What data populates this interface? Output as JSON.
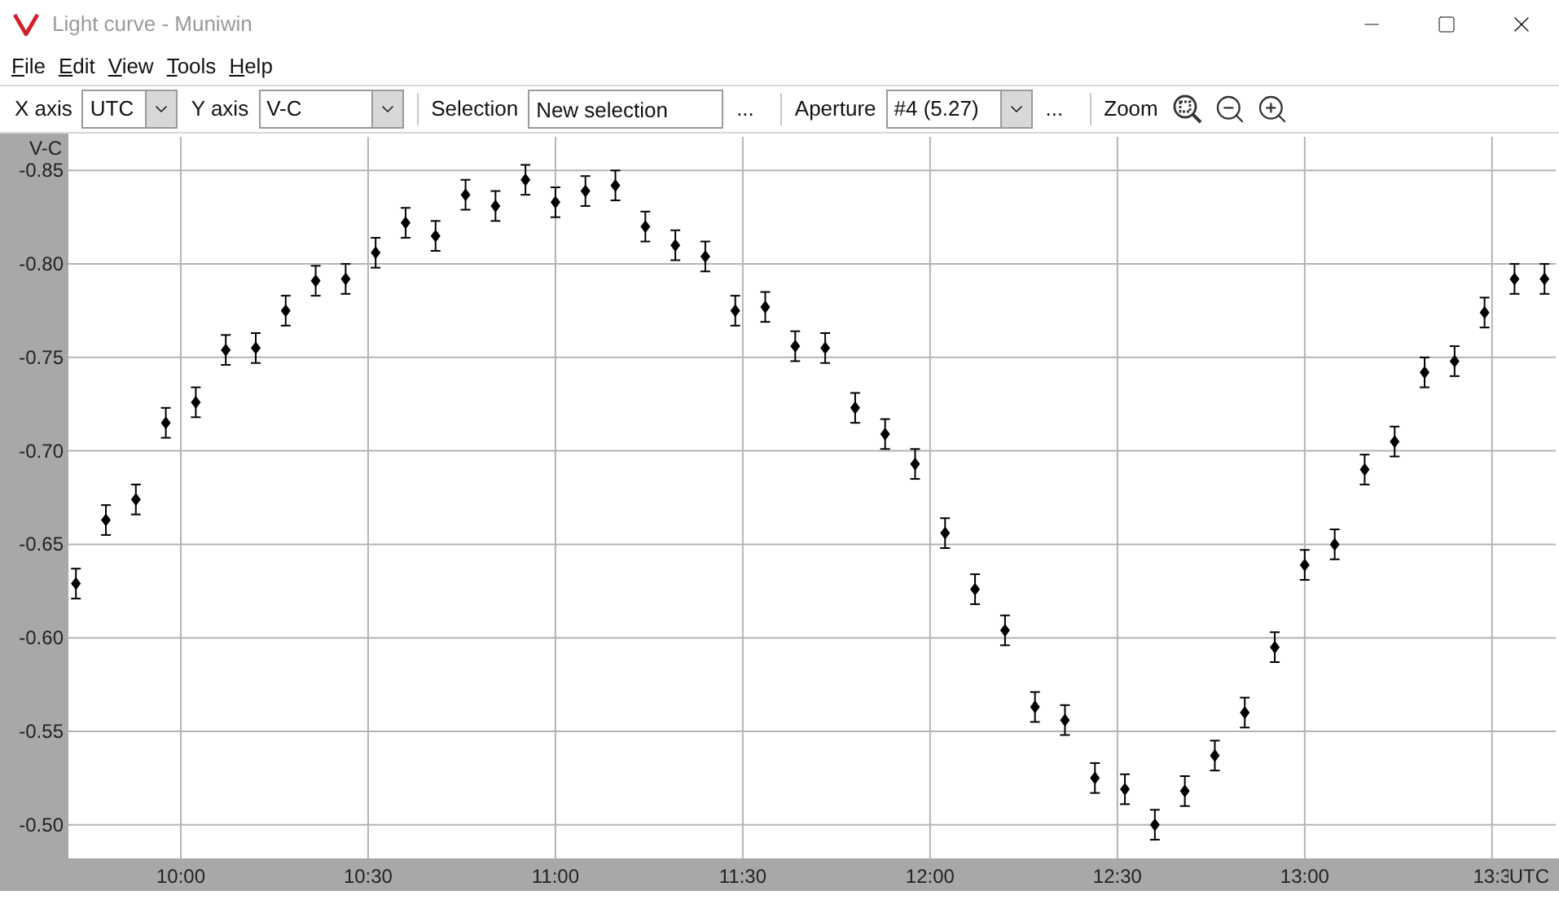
{
  "window": {
    "title": "Light curve - Muniwin"
  },
  "menu": [
    {
      "label": "File"
    },
    {
      "label": "Edit"
    },
    {
      "label": "View"
    },
    {
      "label": "Tools"
    },
    {
      "label": "Help"
    }
  ],
  "toolbar": {
    "x_axis": {
      "label": "X axis",
      "value": "UTC"
    },
    "y_axis": {
      "label": "Y axis",
      "value": "V-C"
    },
    "selection": {
      "label": "Selection",
      "value": "New selection",
      "more": "..."
    },
    "aperture": {
      "label": "Aperture",
      "value": "#4 (5.27)",
      "more": "..."
    },
    "zoom": {
      "label": "Zoom"
    }
  },
  "chart": {
    "chart_data": {
      "type": "scatter",
      "xlabel": "UTC",
      "ylabel": "V-C",
      "grid": true,
      "x": [
        9.72,
        9.8,
        9.88,
        9.96,
        10.04,
        10.12,
        10.2,
        10.28,
        10.36,
        10.44,
        10.52,
        10.6,
        10.68,
        10.76,
        10.84,
        10.92,
        11.0,
        11.08,
        11.16,
        11.24,
        11.32,
        11.4,
        11.48,
        11.56,
        11.64,
        11.72,
        11.8,
        11.88,
        11.96,
        12.04,
        12.12,
        12.2,
        12.28,
        12.36,
        12.44,
        12.52,
        12.6,
        12.68,
        12.76,
        12.84,
        12.92,
        13.0,
        13.08,
        13.16,
        13.24,
        13.32,
        13.4,
        13.48,
        13.56,
        13.64
      ],
      "series": [
        {
          "color": "#000000",
          "errors": [
            0.008,
            0.008,
            0.008,
            0.008,
            0.008,
            0.008,
            0.008,
            0.008,
            0.008,
            0.008,
            0.008,
            0.008,
            0.008,
            0.008,
            0.008,
            0.008,
            0.008,
            0.008,
            0.008,
            0.008,
            0.008,
            0.008,
            0.008,
            0.008,
            0.008,
            0.008,
            0.008,
            0.008,
            0.008,
            0.008,
            0.008,
            0.008,
            0.008,
            0.008,
            0.008,
            0.008,
            0.008,
            0.008,
            0.008,
            0.008,
            0.008,
            0.008,
            0.008,
            0.008,
            0.008,
            0.008,
            0.008,
            0.008,
            0.008,
            0.008
          ],
          "values": [
            -0.629,
            -0.663,
            -0.674,
            -0.715,
            -0.726,
            -0.754,
            -0.755,
            -0.775,
            -0.791,
            -0.792,
            -0.806,
            -0.822,
            -0.815,
            -0.837,
            -0.831,
            -0.845,
            -0.833,
            -0.839,
            -0.842,
            -0.82,
            -0.81,
            -0.804,
            -0.775,
            -0.777,
            -0.756,
            -0.755,
            -0.723,
            -0.709,
            -0.693,
            -0.656,
            -0.626,
            -0.604,
            -0.563,
            -0.556,
            -0.525,
            -0.519,
            -0.5,
            -0.518,
            -0.537,
            -0.56,
            -0.595,
            -0.639,
            -0.65,
            -0.69,
            -0.705,
            -0.742,
            -0.748,
            -0.774,
            -0.792,
            -0.792
          ]
        }
      ],
      "xlim": [
        9.7,
        13.67
      ],
      "ylim": [
        -0.482,
        -0.868
      ],
      "xticks": [
        {
          "value": 10,
          "label": "10:00"
        },
        {
          "value": 10.5,
          "label": "10:30"
        },
        {
          "value": 11,
          "label": "11:00"
        },
        {
          "value": 11.5,
          "label": "11:30"
        },
        {
          "value": 12,
          "label": "12:00"
        },
        {
          "value": 12.5,
          "label": "12:30"
        },
        {
          "value": 13,
          "label": "13:00"
        },
        {
          "value": 13.5,
          "label": "13:3"
        }
      ],
      "yticks": [
        {
          "value": -0.85,
          "label": "-0.85"
        },
        {
          "value": -0.8,
          "label": "-0.80"
        },
        {
          "value": -0.75,
          "label": "-0.75"
        },
        {
          "value": -0.7,
          "label": "-0.70"
        },
        {
          "value": -0.65,
          "label": "-0.65"
        },
        {
          "value": -0.6,
          "label": "-0.60"
        },
        {
          "value": -0.55,
          "label": "-0.55"
        },
        {
          "value": -0.5,
          "label": "-0.50"
        }
      ]
    }
  }
}
